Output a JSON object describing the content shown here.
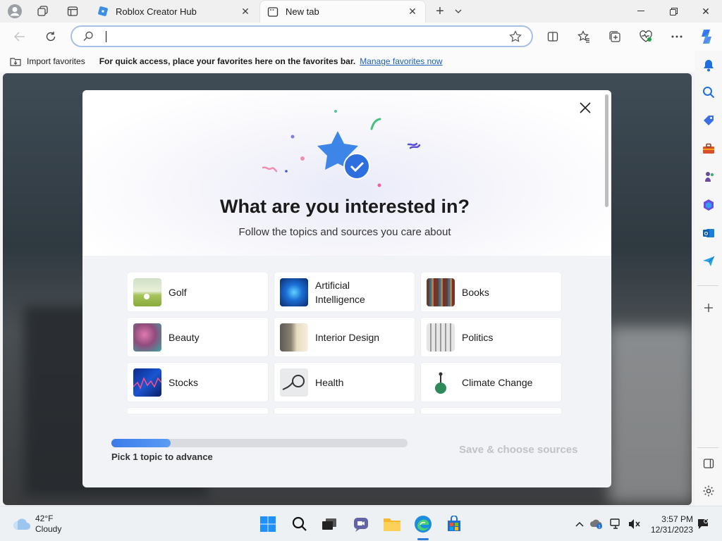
{
  "tabs": [
    {
      "title": "Roblox Creator Hub",
      "active": false
    },
    {
      "title": "New tab",
      "active": true
    }
  ],
  "address": {
    "value": "",
    "placeholder": ""
  },
  "favbar": {
    "import_label": "Import favorites",
    "message": "For quick access, place your favorites here on the favorites bar.",
    "link": "Manage favorites now"
  },
  "modal": {
    "headline": "What are you interested in?",
    "subline": "Follow the topics and sources you care about",
    "topics": [
      {
        "label": "Golf",
        "thumb": "golf"
      },
      {
        "label": "Artificial Intelligence",
        "thumb": "ai"
      },
      {
        "label": "Books",
        "thumb": "books"
      },
      {
        "label": "Beauty",
        "thumb": "beauty"
      },
      {
        "label": "Interior Design",
        "thumb": "interior"
      },
      {
        "label": "Politics",
        "thumb": "politics"
      },
      {
        "label": "Stocks",
        "thumb": "stocks"
      },
      {
        "label": "Health",
        "thumb": "health"
      },
      {
        "label": "Climate Change",
        "thumb": "climate"
      }
    ],
    "progress": 0.2,
    "pick_text": "Pick 1 topic to advance",
    "save_label": "Save & choose sources"
  },
  "taskbar": {
    "weather_temp": "42°F",
    "weather_desc": "Cloudy",
    "time": "3:57 PM",
    "date": "12/31/2023"
  },
  "colors": {
    "accent": "#2a7ad5",
    "link": "#1c5fb8"
  }
}
